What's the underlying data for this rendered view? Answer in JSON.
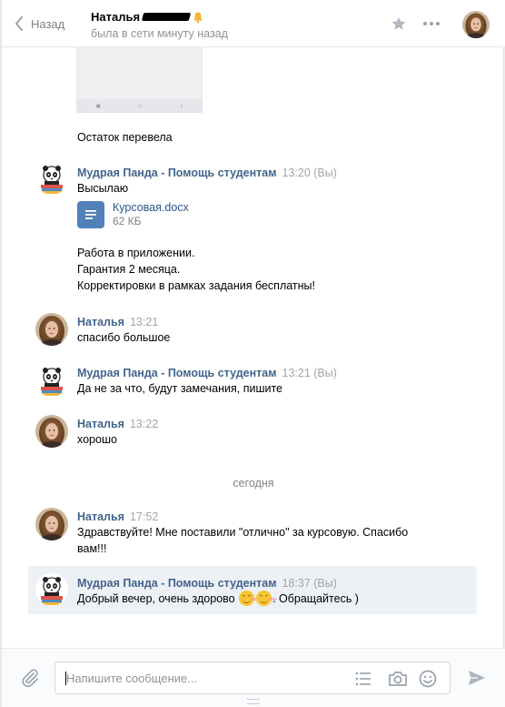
{
  "header": {
    "back_label": "Назад",
    "peer_name": "Наталья",
    "peer_status": "была в сети минуту назад"
  },
  "history": {
    "msg_transfer": "Остаток перевела",
    "m1": {
      "author": "Мудрая Панда - Помощь студентам",
      "time": "13:20 (Вы)",
      "text": "Высылаю",
      "doc_name": "Курсовая.docx",
      "doc_size": "62 КБ",
      "line1": "Работа в приложении.",
      "line2": "Гарантия 2 месяца.",
      "line3": "Корректировки в рамках задания бесплатны!"
    },
    "m2": {
      "author": "Наталья",
      "time": "13:21",
      "text": "спасибо большое"
    },
    "m3": {
      "author": "Мудрая Панда - Помощь студентам",
      "time": "13:21 (Вы)",
      "text": "Да не за что, будут замечания, пишите"
    },
    "m4": {
      "author": "Наталья",
      "time": "13:22",
      "text": "хорошо"
    },
    "date_separator": "сегодня",
    "m5": {
      "author": "Наталья",
      "time": "17:52",
      "line1": "Здравствуйте! Мне поставили \"отлично\" за курсовую. Спасибо",
      "line2": "вам!!!"
    },
    "m6": {
      "author": "Мудрая Панда - Помощь студентам",
      "time": "18:37 (Вы)",
      "text_before": "Добрый вечер, очень здорово ",
      "text_after": ". Обращайтесь )"
    }
  },
  "composer": {
    "placeholder": "Напишите сообщение..."
  },
  "icons": {
    "back": "chevron-left-icon",
    "star": "star-icon",
    "more": "more-icon",
    "attach": "paperclip-icon",
    "template": "list-icon",
    "camera": "camera-icon",
    "emoji": "smile-icon",
    "send": "send-icon",
    "document": "document-icon"
  },
  "colors": {
    "author_link": "#42648b",
    "doc_link": "#2a5885",
    "doc_icon": "#5181b8",
    "highlight_bg": "#edf0f5",
    "muted": "#828282"
  }
}
